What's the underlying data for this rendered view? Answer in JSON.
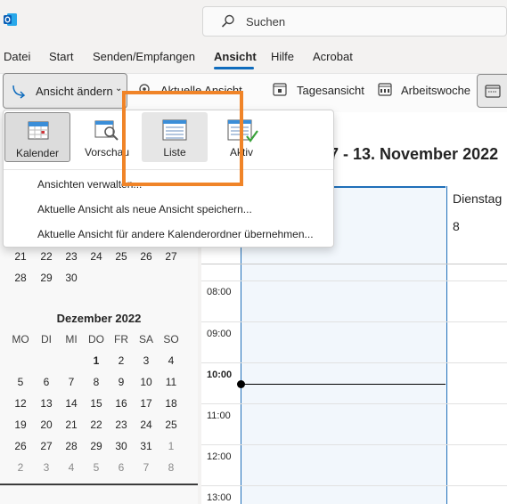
{
  "search": {
    "placeholder": "Suchen"
  },
  "menu": {
    "items": [
      "Datei",
      "Start",
      "Senden/Empfangen",
      "Ansicht",
      "Hilfe",
      "Acrobat"
    ],
    "active": "Ansicht"
  },
  "ribbon": {
    "change_view": "Ansicht ändern",
    "current_view": "Aktuelle Ansicht",
    "day_view": "Tagesansicht",
    "work_week": "Arbeitswoche"
  },
  "dropdown": {
    "tiles": [
      "Kalender",
      "Vorschau",
      "Liste",
      "Aktiv"
    ],
    "items": [
      "Ansichten verwalten...",
      "Aktuelle Ansicht als neue Ansicht speichern...",
      "Aktuelle Ansicht für andere Kalenderordner übernehmen..."
    ]
  },
  "calendar": {
    "range_title": "7 - 13. November 2022",
    "day_header": {
      "name": "Dienstag",
      "date": "8"
    },
    "times": [
      "08:00",
      "09:00",
      "10:00",
      "11:00",
      "12:00",
      "13:00"
    ],
    "current_time": "10:00"
  },
  "mini_nov": {
    "rows": [
      [
        "21",
        "22",
        "23",
        "24",
        "25",
        "26",
        "27"
      ],
      [
        "28",
        "29",
        "30",
        "",
        "",
        "",
        ""
      ]
    ]
  },
  "mini_dec": {
    "title": "Dezember 2022",
    "weekdays": [
      "MO",
      "DI",
      "MI",
      "DO",
      "FR",
      "SA",
      "SO"
    ],
    "rows": [
      [
        "",
        "",
        "",
        "1",
        "2",
        "3",
        "4"
      ],
      [
        "5",
        "6",
        "7",
        "8",
        "9",
        "10",
        "11"
      ],
      [
        "12",
        "13",
        "14",
        "15",
        "16",
        "17",
        "18"
      ],
      [
        "19",
        "20",
        "21",
        "22",
        "23",
        "24",
        "25"
      ],
      [
        "26",
        "27",
        "28",
        "29",
        "30",
        "31",
        "1"
      ],
      [
        "2",
        "3",
        "4",
        "5",
        "6",
        "7",
        "8"
      ]
    ]
  },
  "colors": {
    "accent": "#0f6cbd",
    "highlight": "#f08428",
    "selected_tile": "#dcdcdc"
  }
}
